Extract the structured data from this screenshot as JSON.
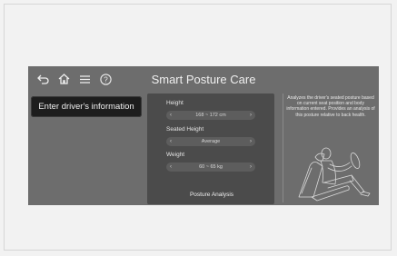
{
  "header": {
    "title": "Smart Posture Care",
    "icons": [
      "back-icon",
      "home-icon",
      "menu-icon",
      "help-icon"
    ]
  },
  "left": {
    "enter_button_label": "Enter driver's information"
  },
  "form": {
    "height_label": "Height",
    "height_value": "168 ~ 172 cm",
    "seated_height_label": "Seated Height",
    "seated_height_value": "Average",
    "weight_label": "Weight",
    "weight_value": "60 ~ 65 kg",
    "analysis_button_label": "Posture Analysis"
  },
  "info": {
    "description": "Analyzes the driver's seated posture based on current seat position and body information entered. Provides an analysis of this posture relative to back health."
  },
  "colors": {
    "screen_bg": "#6d6d6d",
    "panel_bg": "#4b4b4b",
    "button_bg": "#1d1d1d",
    "text": "#efefef"
  }
}
